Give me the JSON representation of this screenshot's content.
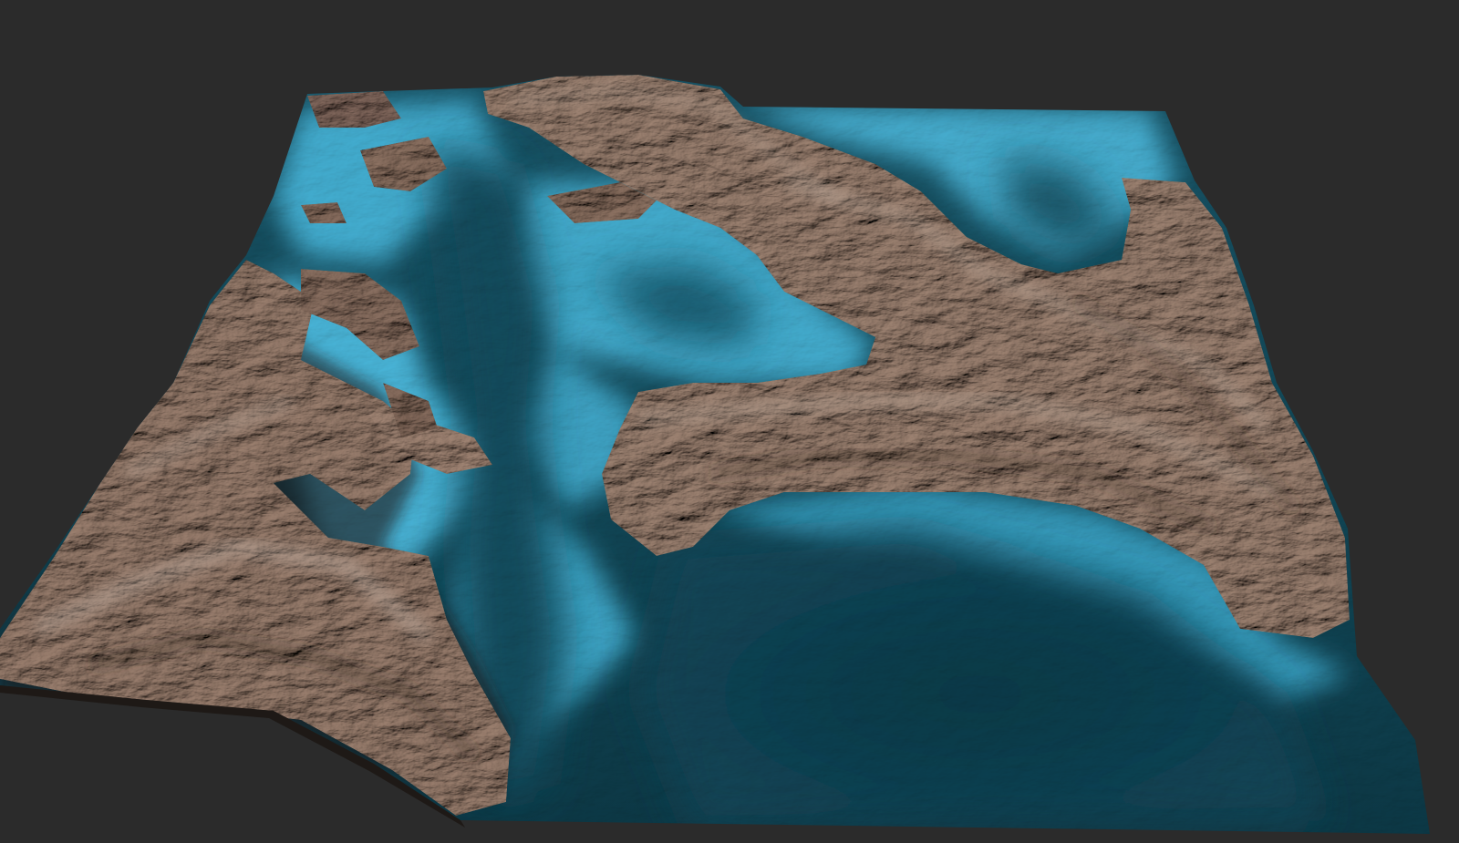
{
  "scene": {
    "kind": "3d-terrain-heightmap-render",
    "colors": {
      "background": "#2b2b2b",
      "deep_water": "#0f3c48",
      "mid_water": "#2a7e96",
      "shallow_water": "#5ec3e0",
      "rock_dark": "#3f3028",
      "rock_mid": "#8a7366",
      "rock_light": "#c3b2a5"
    }
  }
}
